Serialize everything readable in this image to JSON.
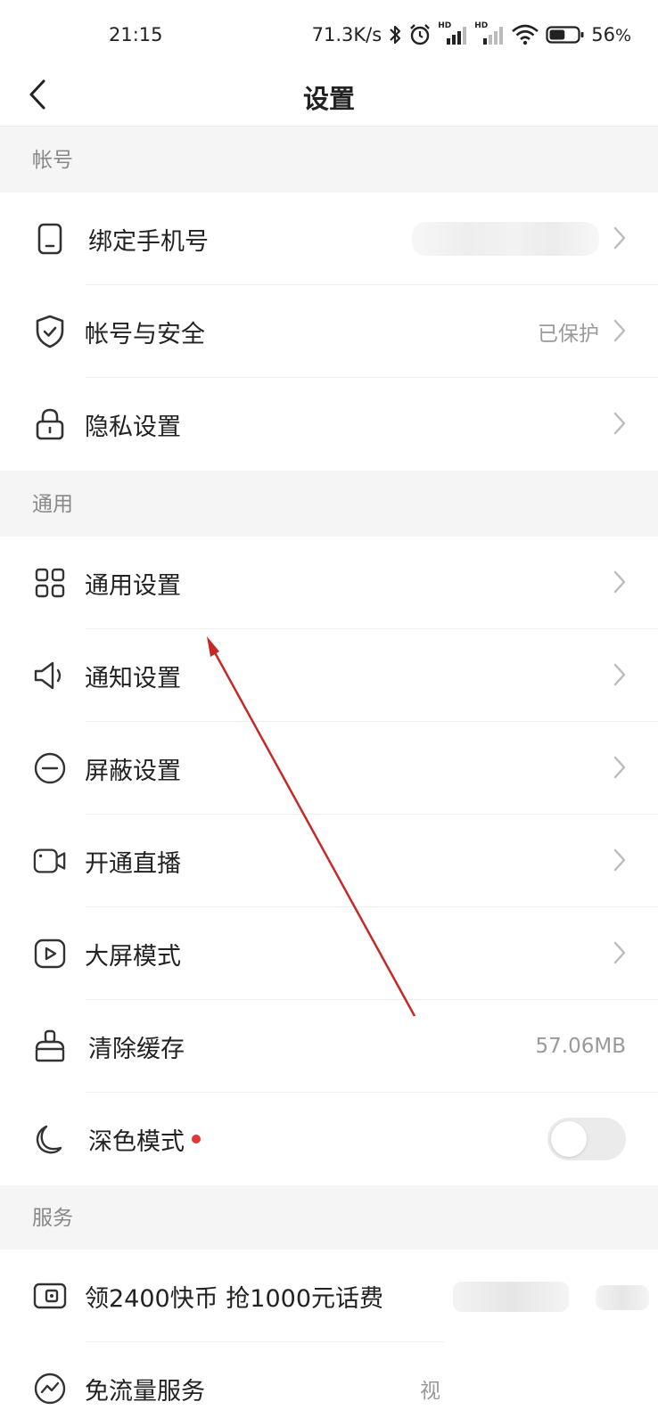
{
  "status_bar": {
    "time": "21:15",
    "network_speed": "71.3K/s",
    "hd_badge": "HD",
    "battery_percent": "56",
    "percent_sign": "%",
    "battery_level": 0.56
  },
  "nav": {
    "back_icon": "chevron-left-icon",
    "title": "设置"
  },
  "sections": {
    "account": {
      "header": "帐号",
      "items": [
        {
          "icon": "phone-icon",
          "label": "绑定手机号",
          "value_redacted": true
        },
        {
          "icon": "shield-check-icon",
          "label": "帐号与安全",
          "value": "已保护"
        },
        {
          "icon": "lock-icon",
          "label": "隐私设置"
        }
      ]
    },
    "general": {
      "header": "通用",
      "items": [
        {
          "icon": "grid-icon",
          "label": "通用设置"
        },
        {
          "icon": "speaker-icon",
          "label": "通知设置"
        },
        {
          "icon": "block-icon",
          "label": "屏蔽设置"
        },
        {
          "icon": "video-camera-icon",
          "label": "开通直播"
        },
        {
          "icon": "play-screen-icon",
          "label": "大屏模式"
        },
        {
          "icon": "broom-icon",
          "label": "清除缓存",
          "value": "57.06MB"
        },
        {
          "icon": "moon-icon",
          "label": "深色模式",
          "toggle": false,
          "red_dot": true
        }
      ]
    },
    "services": {
      "header": "服务",
      "items": [
        {
          "icon": "wallet-icon",
          "label": "领2400快币 抢1000元话费"
        },
        {
          "icon": "data-free-icon",
          "label": "免流量服务",
          "value_partial": "视"
        }
      ]
    }
  },
  "colors": {
    "accent_red": "#e03636",
    "annotation_arrow": "#c62828",
    "section_bg": "#f5f5f5"
  }
}
